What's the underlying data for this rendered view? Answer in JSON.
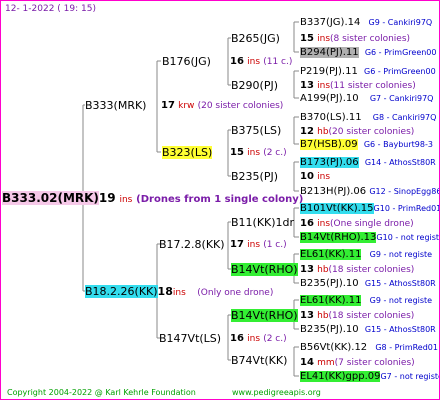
{
  "header": {
    "date": "12-  1-2022  ( 19: 15)"
  },
  "footer": {
    "copyright": "Copyright 2004-2022 @ Karl Kehrle Foundation",
    "site": "www.pedigreeapis.org"
  },
  "root": {
    "name": "B333.02(MRK)",
    "num": "19",
    "ins": "ins",
    "note": "(Drones from 1 single colony)"
  },
  "gen1": [
    {
      "name": "B333(MRK)",
      "num": "17",
      "ins": "krw",
      "note": "(20 sister colonies)"
    },
    {
      "name": "B18.2.26(KK)",
      "num": "18",
      "ins": "ins",
      "note": "(Only one drone)"
    }
  ],
  "gen2": [
    {
      "name": "B176(JG)",
      "num": "16",
      "ins": "ins",
      "note": "(11 c.)"
    },
    {
      "name": "B323(LS)",
      "num": "15",
      "ins": "ins",
      "note": "(2 c.)"
    },
    {
      "name": "B17.2.8(KK)",
      "num": "17",
      "ins": "ins",
      "note": "(1 c.)"
    },
    {
      "name": "B147Vt(LS)",
      "num": "16",
      "ins": "ins",
      "note": "(2 c.)"
    }
  ],
  "gen3": [
    {
      "name": "B265(JG)"
    },
    {
      "name": "B290(PJ)"
    },
    {
      "name": "B375(LS)"
    },
    {
      "name": "B235(PJ)"
    },
    {
      "name": "B11(KK)1dr"
    },
    {
      "name": "B14Vt(RHO)"
    },
    {
      "name": "B14Vt(RHO)"
    },
    {
      "name": "B74Vt(KK)"
    }
  ],
  "gen4": [
    {
      "line": "B337(JG).14",
      "tag": "G9 - Cankiri97Q"
    },
    {
      "line": "15",
      "ins": "ins",
      "note": "(8 sister colonies)"
    },
    {
      "line": "B294(PJ).11",
      "tag": "G6 - PrimGreen00"
    },
    {
      "line": "P219(PJ).11",
      "tag": "G6 - PrimGreen00"
    },
    {
      "line": "13",
      "ins": "ins",
      "note": "(11 sister colonies)"
    },
    {
      "line": "A199(PJ).10",
      "tag": "G7 - Cankiri97Q"
    },
    {
      "line": "B370(LS).11",
      "tag": "G8 - Cankiri97Q"
    },
    {
      "line": "12",
      "ins": "hb",
      "note": "(20 sister colonies)"
    },
    {
      "line": "B7(HSB).09",
      "tag": "G6 - Bayburt98-3"
    },
    {
      "line": "B173(PJ).06",
      "tag": "G14 - AthosSt80R"
    },
    {
      "line": "10",
      "ins": "ins",
      "note": ""
    },
    {
      "line": "B213H(PJ).06",
      "tag": "G12 - SinopEgg86R"
    },
    {
      "line": "B101Vt(KK).15",
      "tag": "G10 - PrimRed01"
    },
    {
      "line": "16",
      "ins": "ins",
      "note": "(One single drone)"
    },
    {
      "line": "B14Vt(RHO).13",
      "tag": "G10 - not registe"
    },
    {
      "line": "EL61(KK).11",
      "tag": "G9 - not registe"
    },
    {
      "line": "13",
      "ins": "hb",
      "note": "(18 sister colonies)"
    },
    {
      "line": "B235(PJ).10",
      "tag": "G15 - AthosSt80R"
    },
    {
      "line": "EL61(KK).11",
      "tag": "G9 - not registe"
    },
    {
      "line": "13",
      "ins": "hb",
      "note": "(18 sister colonies)"
    },
    {
      "line": "B235(PJ).10",
      "tag": "G15 - AthosSt80R"
    },
    {
      "line": "B56Vt(KK).12",
      "tag": "G8 - PrimRed01"
    },
    {
      "line": "14",
      "ins": "mm",
      "note": "(7 sister colonies)"
    },
    {
      "line": "EL41(KK)gpp.09",
      "tag": "G7 - not registe"
    }
  ]
}
